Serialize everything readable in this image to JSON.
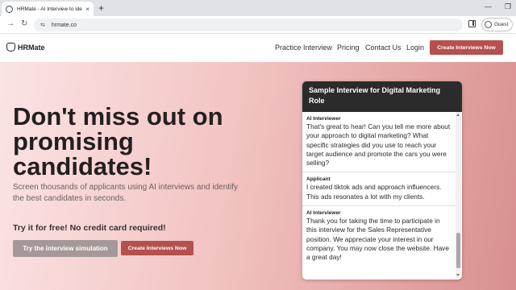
{
  "browser": {
    "tab_title": "HRMate - AI Interview to identi",
    "tab_close": "×",
    "new_tab": "+",
    "url": "hrmate.co",
    "back_glyph": "→",
    "reload_glyph": "↻",
    "site_info_glyph": "⇆",
    "minimize_glyph": "—",
    "restore_glyph": "❐",
    "profile_label": "Guest"
  },
  "header": {
    "logo_text": "HRMate",
    "nav": [
      "Practice Interview",
      "Pricing",
      "Contact Us",
      "Login"
    ],
    "cta_label": "Create Interviews Now"
  },
  "hero": {
    "heading": "Don't miss out on promising candidates!",
    "subtext": "Screen thousands of applicants using AI interviews and identify the best candidates in seconds.",
    "free_text": "Try it for free! No credit card required!",
    "simulation_button": "Try the interview simulation",
    "create_button": "Create Interviews Now"
  },
  "sample": {
    "title": "Sample Interview for Digital Marketing Role",
    "messages": [
      {
        "role": "AI Interviewer",
        "text": "That's great to hear! Can you tell me more about your approach to digital marketing? What specific strategies did you use to reach your target audience and promote the cars you were selling?"
      },
      {
        "role": "Applicant",
        "text": "I created tiktok ads and approach influencers. This ads resonates a lot with my clients."
      },
      {
        "role": "AI Interviewer",
        "text": "Thank you for taking the time to participate in this interview for the Sales Representative position. We appreciate your interest in our company. You may now close the website. Have a great day!"
      }
    ]
  },
  "colors": {
    "brand": "#b5504e",
    "hero_start": "#fbe4e4",
    "hero_end": "#d8908d",
    "panel_header": "#2b2b2b"
  }
}
